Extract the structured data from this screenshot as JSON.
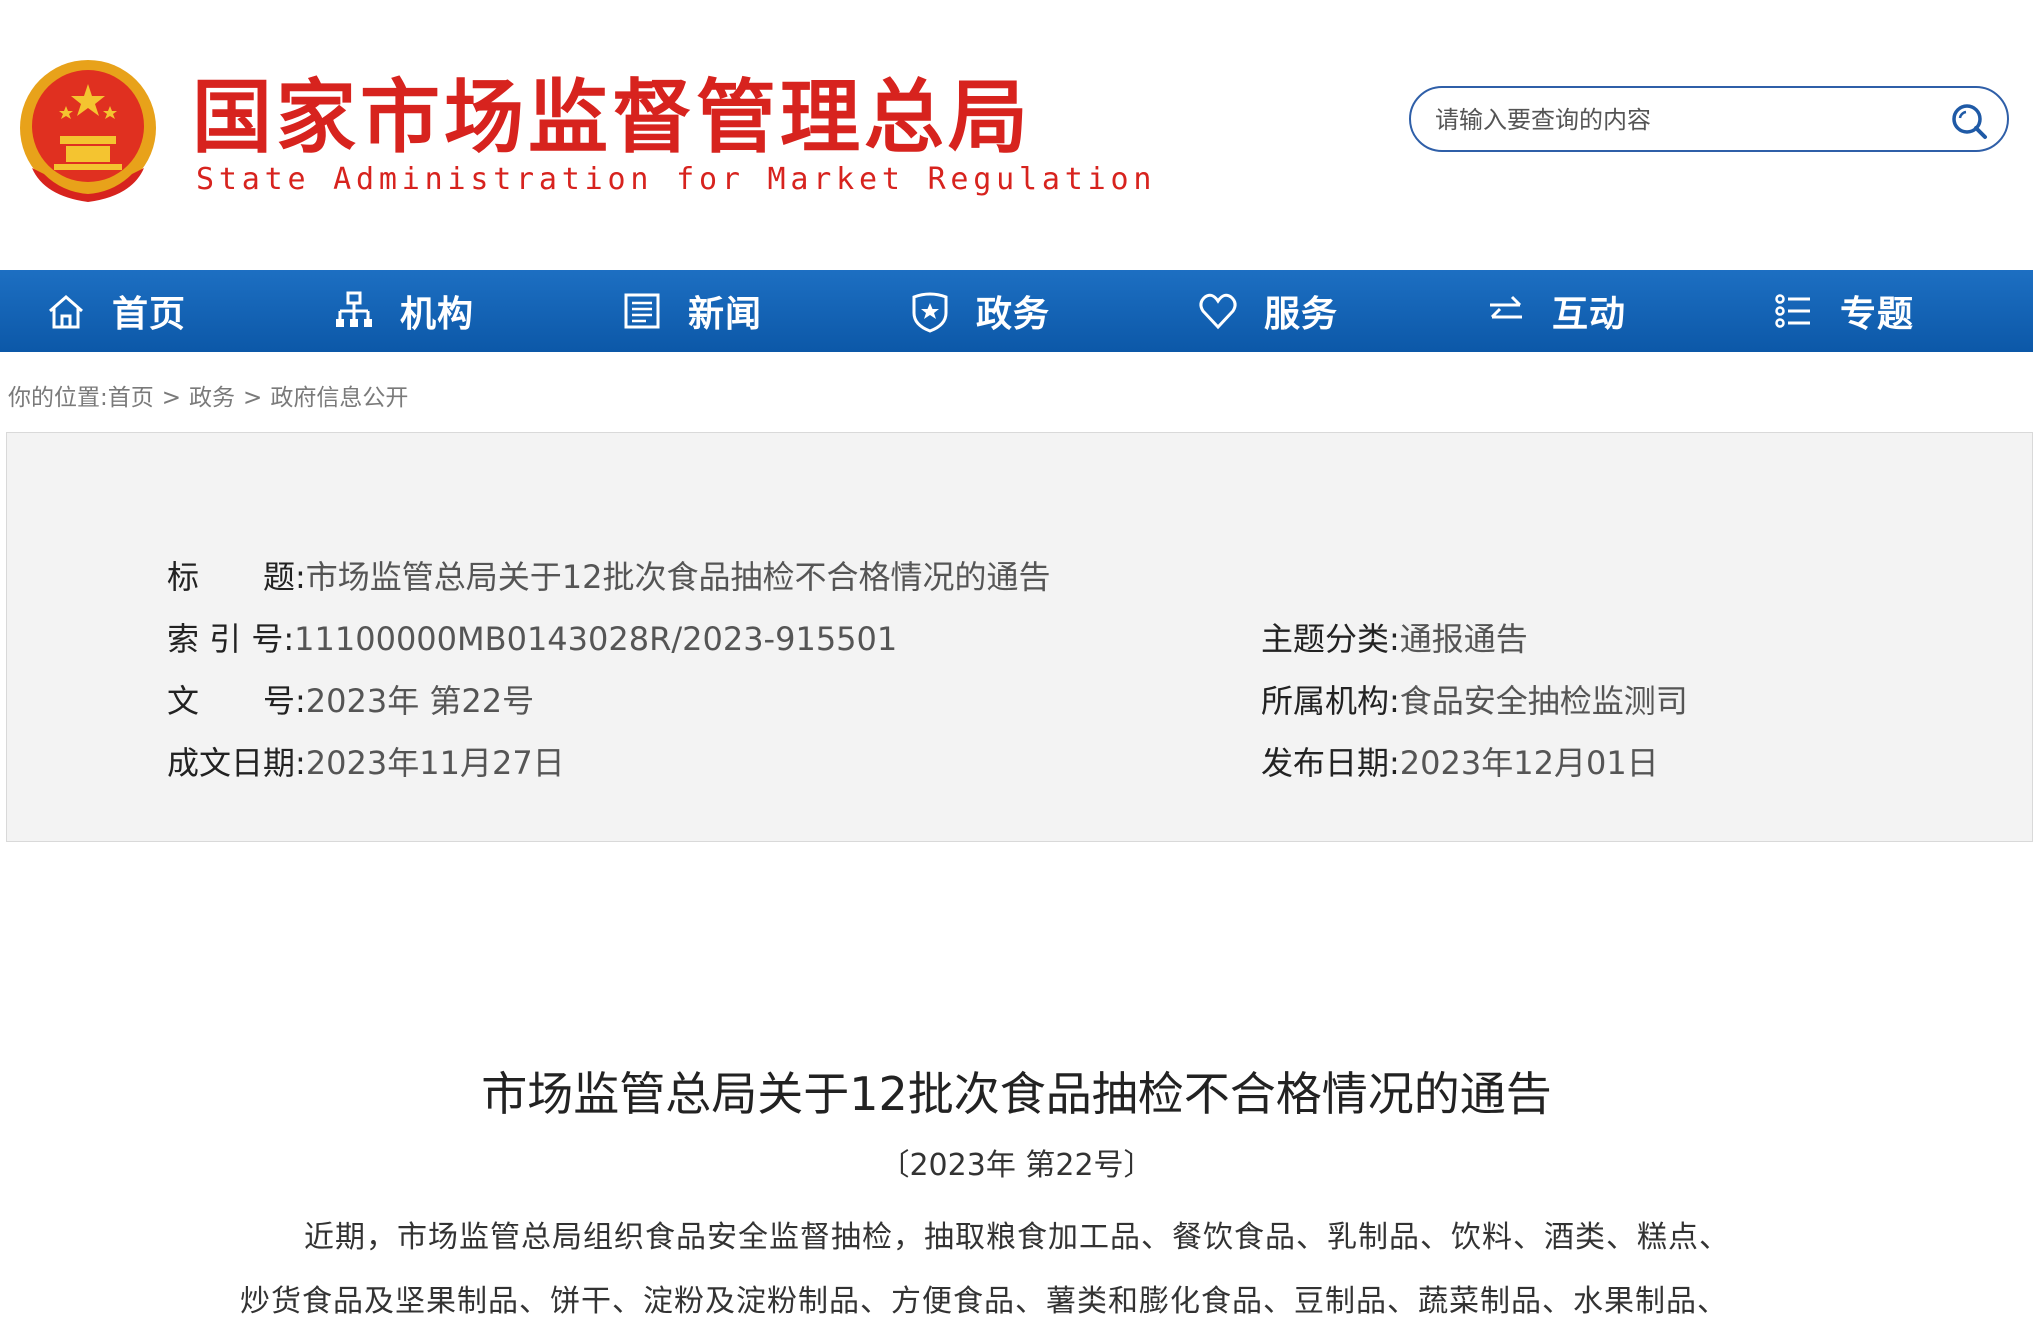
{
  "site": {
    "name_cn": "国家市场监督管理总局",
    "name_en": "State Administration for Market Regulation",
    "colors": {
      "brand_red": "#d7231e",
      "nav_blue": "#1565b8",
      "search_border": "#2f5fa8"
    }
  },
  "search": {
    "placeholder": "请输入要查询的内容",
    "icon": "search-icon"
  },
  "nav": {
    "items": [
      {
        "label": "首页",
        "icon": "home-icon"
      },
      {
        "label": "机构",
        "icon": "org-chart-icon"
      },
      {
        "label": "新闻",
        "icon": "newspaper-icon"
      },
      {
        "label": "政务",
        "icon": "shield-star-icon"
      },
      {
        "label": "服务",
        "icon": "heart-icon"
      },
      {
        "label": "互动",
        "icon": "exchange-arrows-icon"
      },
      {
        "label": "专题",
        "icon": "list-icon"
      }
    ]
  },
  "breadcrumb": {
    "prefix": "你的位置:",
    "items": [
      "首页",
      "政务",
      "政府信息公开"
    ],
    "separator": ">"
  },
  "meta": {
    "title_label": "标　　题:",
    "title_value": "市场监管总局关于12批次食品抽检不合格情况的通告",
    "index_label": "索 引 号:",
    "index_value": "11100000MB0143028R/2023-915501",
    "topic_label": "主题分类:",
    "topic_value": "通报通告",
    "doc_no_label": "文　　号:",
    "doc_no_value": "2023年 第22号",
    "agency_label": "所属机构:",
    "agency_value": "食品安全抽检监测司",
    "written_label": "成文日期:",
    "written_value": "2023年11月27日",
    "publish_label": "发布日期:",
    "publish_value": "2023年12月01日"
  },
  "article": {
    "title": "市场监管总局关于12批次食品抽检不合格情况的通告",
    "subtitle": "〔2023年 第22号〕",
    "line1": "近期，市场监管总局组织食品安全监督抽检，抽取粮食加工品、餐饮食品、乳制品、饮料、酒类、糕点、",
    "line2": "炒货食品及坚果制品、饼干、淀粉及淀粉制品、方便食品、薯类和膨化食品、豆制品、蔬菜制品、水果制品、"
  }
}
